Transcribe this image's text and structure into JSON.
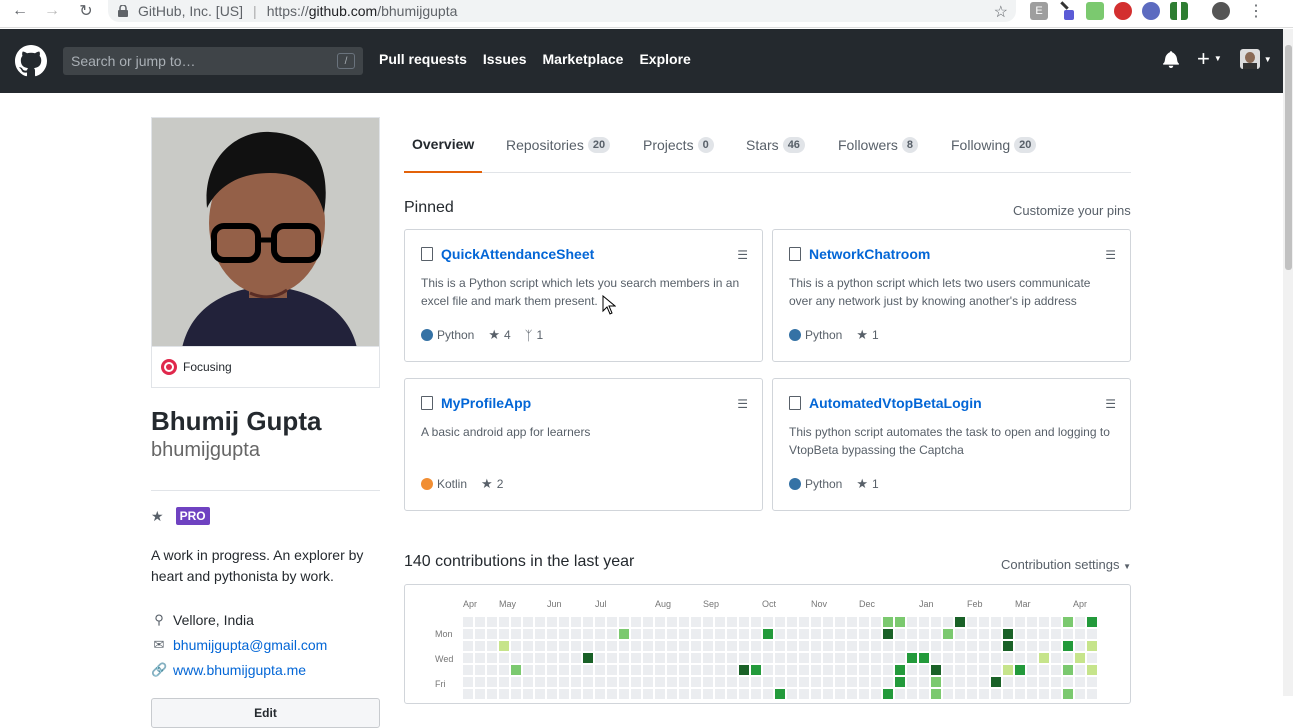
{
  "browser": {
    "origin": "GitHub, Inc. [US]",
    "url_prefix": "https://",
    "url_host": "github.com",
    "url_path": "/bhumijgupta"
  },
  "header": {
    "search_placeholder": "Search or jump to…",
    "search_key": "/",
    "nav": [
      "Pull requests",
      "Issues",
      "Marketplace",
      "Explore"
    ]
  },
  "profile": {
    "status": "Focusing",
    "full_name": "Bhumij Gupta",
    "login": "bhumijgupta",
    "pro_badge": "PRO",
    "bio": "A work in progress. An explorer by heart and pythonista by work.",
    "location": "Vellore, India",
    "email": "bhumijgupta@gmail.com",
    "website": "www.bhumijgupta.me",
    "edit_label": "Edit"
  },
  "tabs": [
    {
      "label": "Overview",
      "count": ""
    },
    {
      "label": "Repositories",
      "count": "20"
    },
    {
      "label": "Projects",
      "count": "0"
    },
    {
      "label": "Stars",
      "count": "46"
    },
    {
      "label": "Followers",
      "count": "8"
    },
    {
      "label": "Following",
      "count": "20"
    }
  ],
  "pinned": {
    "title": "Pinned",
    "customize": "Customize your pins",
    "repos": [
      {
        "name": "QuickAttendanceSheet",
        "desc": "This is a Python script which lets you search members in an excel file and mark them present.",
        "lang": "Python",
        "lang_color": "#3572A5",
        "stars": "4",
        "forks": "1"
      },
      {
        "name": "NetworkChatroom",
        "desc": "This is a python script which lets two users communicate over any network just by knowing another's ip address",
        "lang": "Python",
        "lang_color": "#3572A5",
        "stars": "1",
        "forks": ""
      },
      {
        "name": "MyProfileApp",
        "desc": "A basic android app for learners",
        "lang": "Kotlin",
        "lang_color": "#F18E33",
        "stars": "2",
        "forks": ""
      },
      {
        "name": "AutomatedVtopBetaLogin",
        "desc": "This python script automates the task to open and logging to VtopBeta bypassing the Captcha",
        "lang": "Python",
        "lang_color": "#3572A5",
        "stars": "1",
        "forks": ""
      }
    ]
  },
  "contributions": {
    "title": "140 contributions in the last year",
    "settings": "Contribution settings",
    "months": [
      "Apr",
      "May",
      "Jun",
      "Jul",
      "Aug",
      "Sep",
      "Oct",
      "Nov",
      "Dec",
      "Jan",
      "Feb",
      "Mar",
      "Apr"
    ],
    "days": [
      "Mon",
      "Wed",
      "Fri"
    ],
    "colors": [
      "#ebedf0",
      "#c6e48b",
      "#7bc96f",
      "#239a3b",
      "#196127"
    ]
  }
}
